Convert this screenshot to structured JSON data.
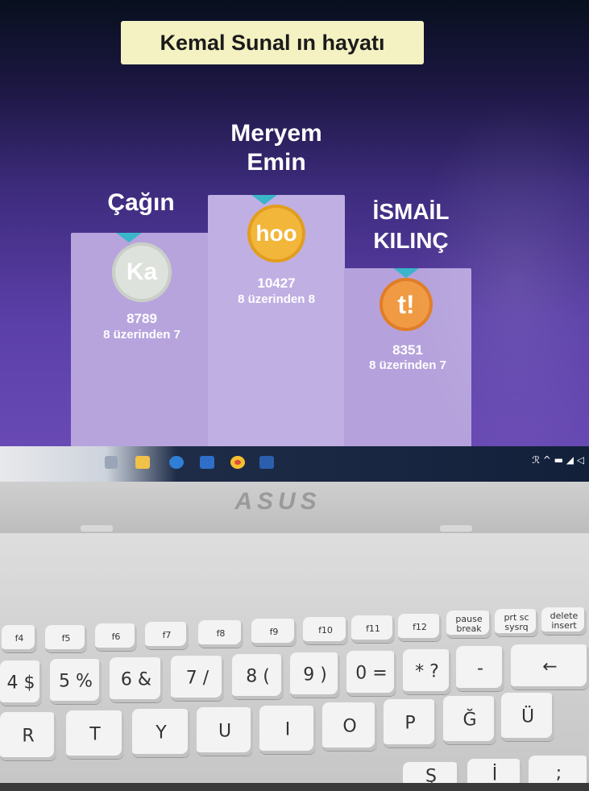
{
  "screen": {
    "quiz_title": "Kemal Sunal ın hayatı",
    "podium": [
      {
        "rank": 1,
        "name": "Meryem Emin",
        "medal_text": "hoo",
        "medal": "gold",
        "score": "10427",
        "result": "8 üzerinden 8"
      },
      {
        "rank": 2,
        "name": "Çağın",
        "medal_text": "Ka",
        "medal": "silver",
        "score": "8789",
        "result": "8 üzerinden 7"
      },
      {
        "rank": 3,
        "name": "İSMAİL KILINÇ",
        "medal_text": "t!",
        "medal": "bronze",
        "score": "8351",
        "result": "8 üzerinden 7"
      }
    ],
    "taskbar": {
      "icons": [
        "task-view-icon",
        "file-explorer-icon",
        "edge-icon",
        "mail-icon",
        "chrome-icon",
        "word-icon"
      ],
      "tray_text": "ℛ ^ ▬ ◢ ◁"
    }
  },
  "laptop": {
    "brand": "ASUS",
    "fn_keys": [
      "f4",
      "f5",
      "f6",
      "f7",
      "f8",
      "f9",
      "f10",
      "f11",
      "f12",
      "pause break",
      "prt sc sysrq",
      "delete insert"
    ],
    "number_row": [
      "4 $",
      "5 %",
      "6 &",
      "7 /",
      "8 (",
      "9 )",
      "0 =",
      "* ?",
      "-",
      "←"
    ],
    "letter_row": [
      "R",
      "T",
      "Y",
      "U",
      "I",
      "O",
      "P",
      "Ğ",
      "Ü"
    ],
    "bottom_row": [
      "Ş",
      "İ",
      ";"
    ]
  }
}
